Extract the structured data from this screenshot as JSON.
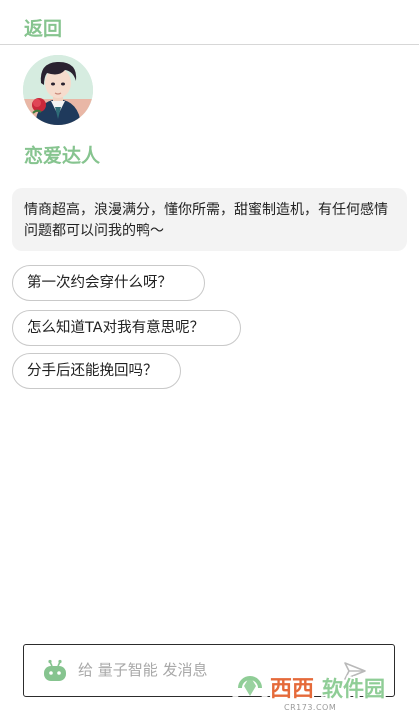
{
  "header": {
    "back_label": "返回"
  },
  "agent": {
    "name": "恋爱达人",
    "intro": "情商超高，浪漫满分，懂你所需，甜蜜制造机，有任何感情问题都可以问我的鸭～"
  },
  "suggestions": [
    {
      "label": "第一次约会穿什么呀？"
    },
    {
      "label": "怎么知道TA对我有意思呢？"
    },
    {
      "label": "分手后还能挽回吗？"
    }
  ],
  "input": {
    "placeholder": "给 量子智能 发消息",
    "value": ""
  },
  "watermark": {
    "text": "西西软件园",
    "site": "CR173.COM"
  },
  "colors": {
    "accent": "#86c48f",
    "bubble_bg": "#f3f3f3",
    "chip_border": "#c9c9c9",
    "watermark": "#8fcd96"
  }
}
